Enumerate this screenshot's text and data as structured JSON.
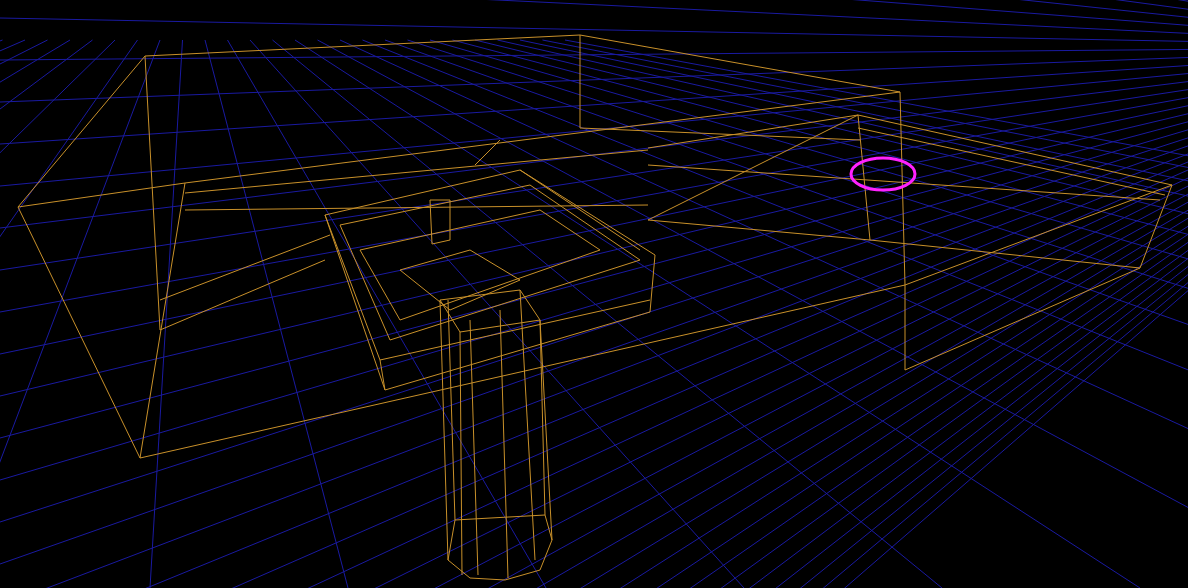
{
  "viewport": {
    "grid": true,
    "selection_ring": true
  }
}
